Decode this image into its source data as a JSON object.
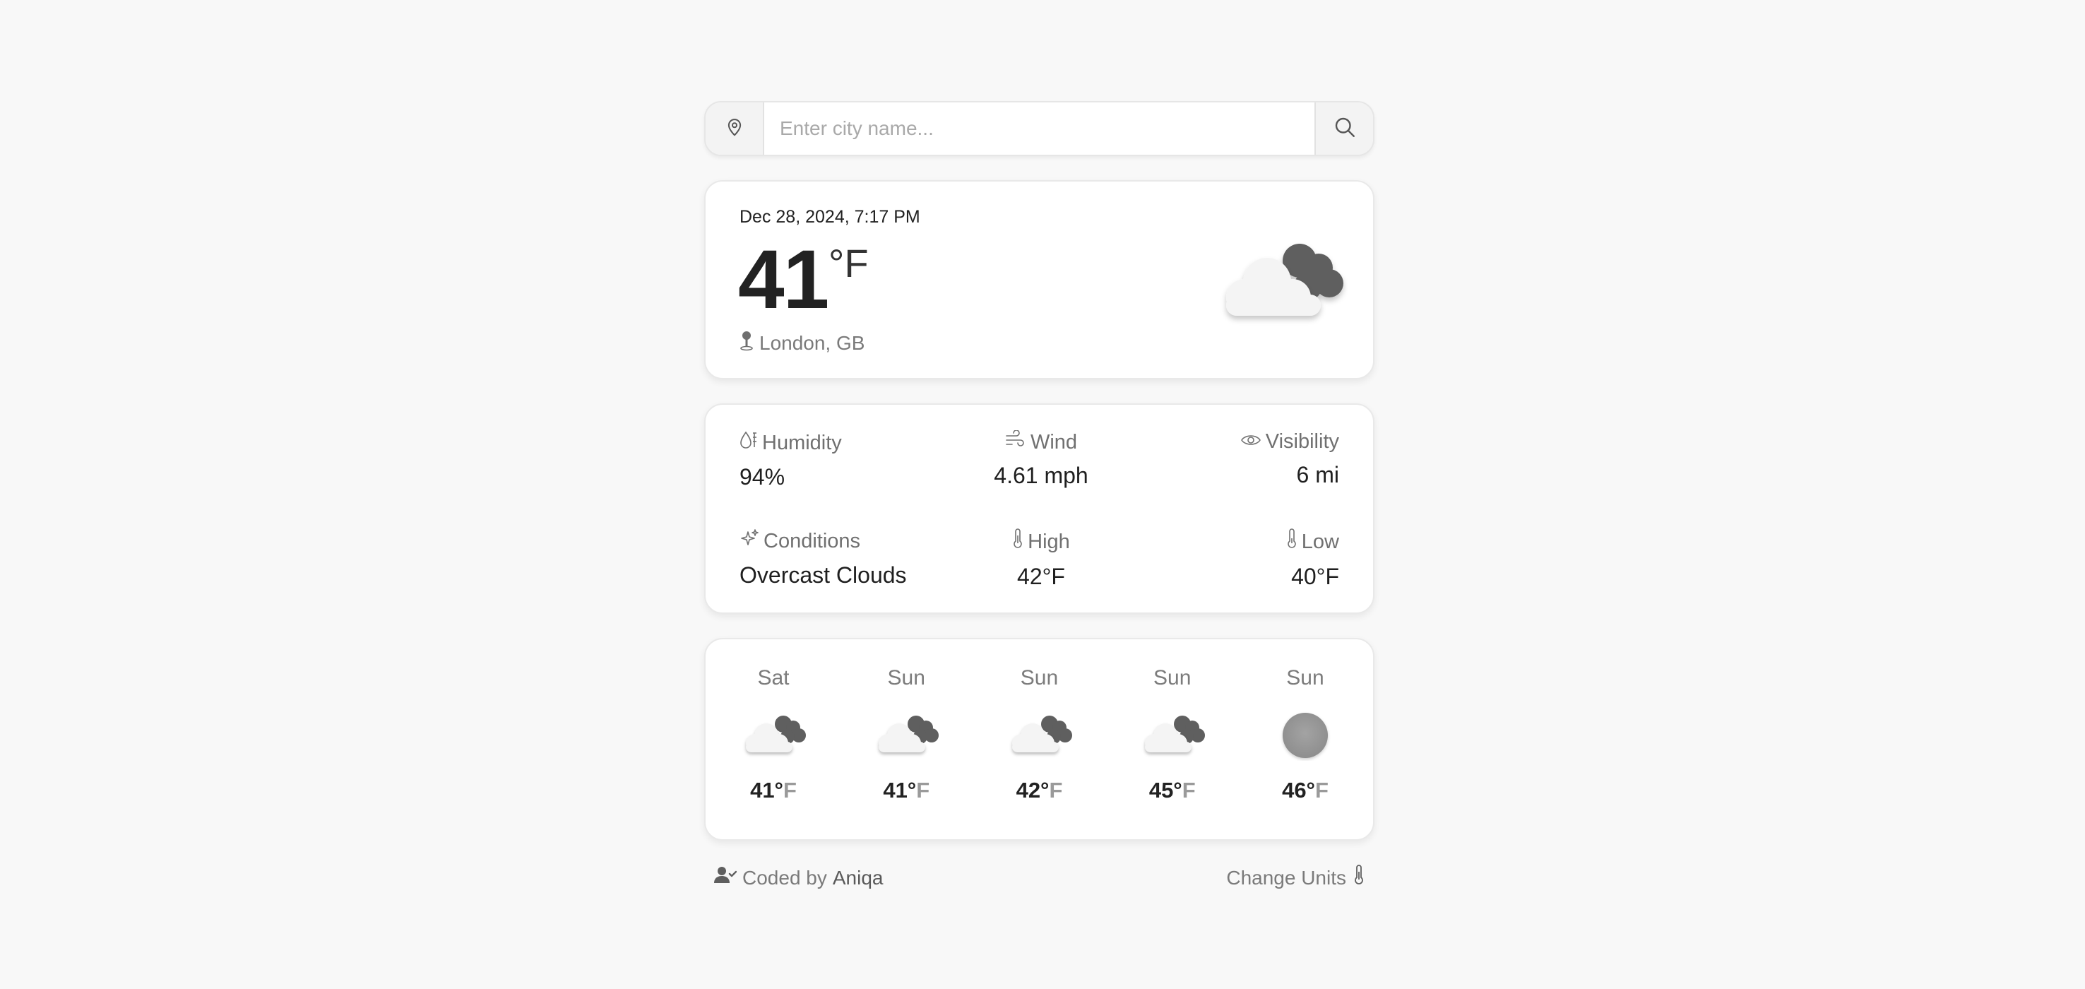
{
  "search": {
    "placeholder": "Enter city name...",
    "location_icon": "map-pin-icon",
    "search_icon": "search-icon"
  },
  "current": {
    "datetime": "Dec 28, 2024, 7:17 PM",
    "temperature": "41",
    "unit": "°F",
    "location": "London, GB",
    "condition_icon": "cloud-icon"
  },
  "details": {
    "humidity": {
      "label": "Humidity",
      "value": "94%",
      "icon": "humidity-icon"
    },
    "wind": {
      "label": "Wind",
      "value": "4.61 mph",
      "icon": "wind-icon"
    },
    "visibility": {
      "label": "Visibility",
      "value": "6 mi",
      "icon": "eye-icon"
    },
    "conditions": {
      "label": "Conditions",
      "value": "Overcast Clouds",
      "icon": "sparkles-icon"
    },
    "high": {
      "label": "High",
      "value": "42°F",
      "icon": "thermometer-icon"
    },
    "low": {
      "label": "Low",
      "value": "40°F",
      "icon": "thermometer-icon"
    }
  },
  "forecast": [
    {
      "day": "Sat",
      "temp": "41°",
      "unit": "F",
      "icon": "cloud-icon"
    },
    {
      "day": "Sun",
      "temp": "41°",
      "unit": "F",
      "icon": "cloud-icon"
    },
    {
      "day": "Sun",
      "temp": "42°",
      "unit": "F",
      "icon": "cloud-icon"
    },
    {
      "day": "Sun",
      "temp": "45°",
      "unit": "F",
      "icon": "cloud-icon"
    },
    {
      "day": "Sun",
      "temp": "46°",
      "unit": "F",
      "icon": "moon-icon"
    }
  ],
  "footer": {
    "credit_prefix": "Coded by",
    "author": "Aniqa",
    "change_units": "Change Units"
  }
}
